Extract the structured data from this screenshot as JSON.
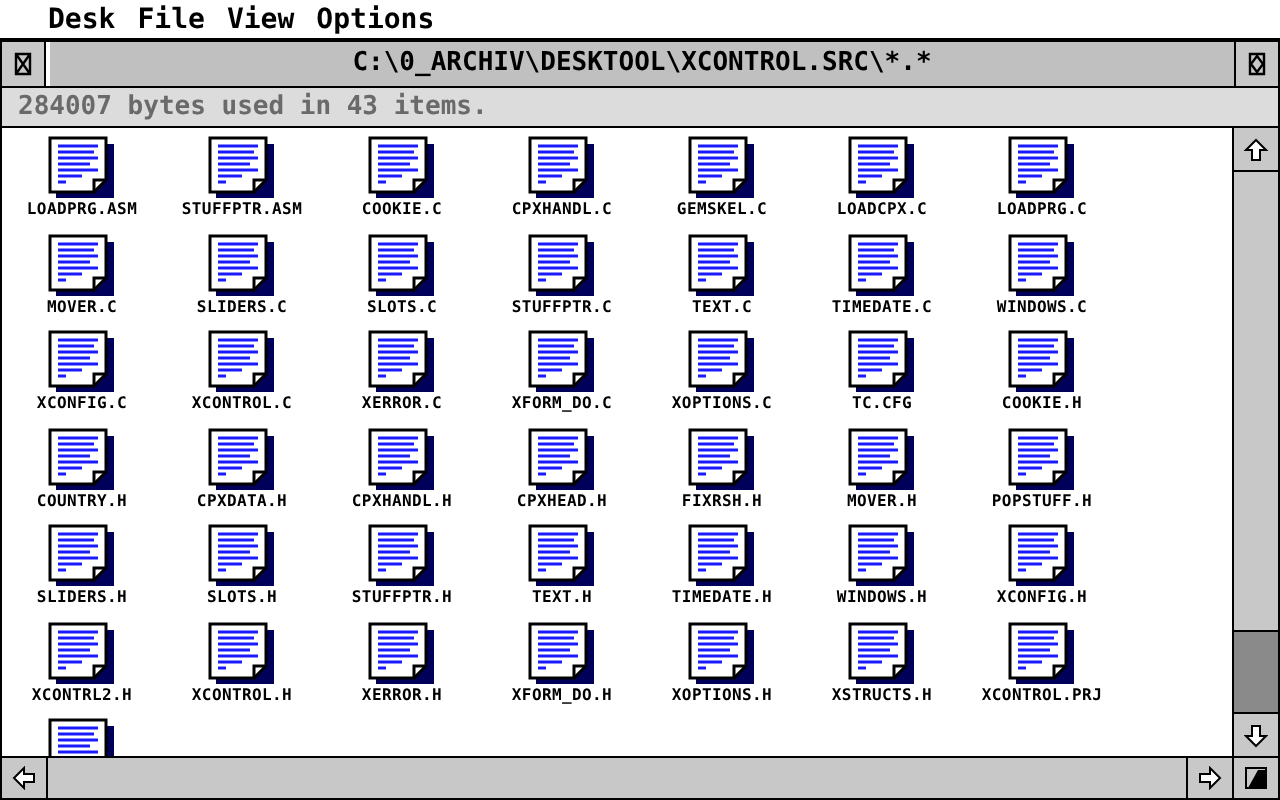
{
  "menu": [
    "Desk",
    "File",
    "View",
    "Options"
  ],
  "window": {
    "title": "C:\\0_ARCHIV\\DESKTOOL\\XCONTROL.SRC\\*.*",
    "info": "284007 bytes used in 43 items."
  },
  "items": [
    {
      "kind": "document",
      "name": "LOADPRG.ASM"
    },
    {
      "kind": "document",
      "name": "STUFFPTR.ASM"
    },
    {
      "kind": "document",
      "name": "COOKIE.C"
    },
    {
      "kind": "document",
      "name": "CPXHANDL.C"
    },
    {
      "kind": "document",
      "name": "GEMSKEL.C"
    },
    {
      "kind": "document",
      "name": "LOADCPX.C"
    },
    {
      "kind": "document",
      "name": "LOADPRG.C"
    },
    {
      "kind": "document",
      "name": "MOVER.C"
    },
    {
      "kind": "document",
      "name": "SLIDERS.C"
    },
    {
      "kind": "document",
      "name": "SLOTS.C"
    },
    {
      "kind": "document",
      "name": "STUFFPTR.C"
    },
    {
      "kind": "document",
      "name": "TEXT.C"
    },
    {
      "kind": "document",
      "name": "TIMEDATE.C"
    },
    {
      "kind": "document",
      "name": "WINDOWS.C"
    },
    {
      "kind": "document",
      "name": "XCONFIG.C"
    },
    {
      "kind": "document",
      "name": "XCONTROL.C"
    },
    {
      "kind": "document",
      "name": "XERROR.C"
    },
    {
      "kind": "document",
      "name": "XFORM_DO.C"
    },
    {
      "kind": "document",
      "name": "XOPTIONS.C"
    },
    {
      "kind": "document",
      "name": "TC.CFG"
    },
    {
      "kind": "document",
      "name": "COOKIE.H"
    },
    {
      "kind": "document",
      "name": "COUNTRY.H"
    },
    {
      "kind": "document",
      "name": "CPXDATA.H"
    },
    {
      "kind": "document",
      "name": "CPXHANDL.H"
    },
    {
      "kind": "document",
      "name": "CPXHEAD.H"
    },
    {
      "kind": "document",
      "name": "FIXRSH.H"
    },
    {
      "kind": "document",
      "name": "MOVER.H"
    },
    {
      "kind": "document",
      "name": "POPSTUFF.H"
    },
    {
      "kind": "document",
      "name": "SLIDERS.H"
    },
    {
      "kind": "document",
      "name": "SLOTS.H"
    },
    {
      "kind": "document",
      "name": "STUFFPTR.H"
    },
    {
      "kind": "document",
      "name": "TEXT.H"
    },
    {
      "kind": "document",
      "name": "TIMEDATE.H"
    },
    {
      "kind": "document",
      "name": "WINDOWS.H"
    },
    {
      "kind": "document",
      "name": "XCONFIG.H"
    },
    {
      "kind": "document",
      "name": "XCONTRL2.H"
    },
    {
      "kind": "document",
      "name": "XCONTROL.H"
    },
    {
      "kind": "document",
      "name": "XERROR.H"
    },
    {
      "kind": "document",
      "name": "XFORM_DO.H"
    },
    {
      "kind": "document",
      "name": "XOPTIONS.H"
    },
    {
      "kind": "document",
      "name": "XSTRUCTS.H"
    },
    {
      "kind": "document",
      "name": "XCONTROL.PRJ"
    },
    {
      "kind": "document"
    }
  ]
}
